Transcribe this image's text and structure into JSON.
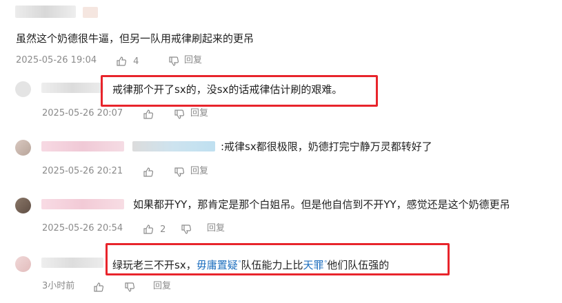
{
  "comments": [
    {
      "text": "虽然这个奶德很牛逼，但另一队用戒律刷起来的更吊",
      "date": "2025-05-26 19:04",
      "likes": "4",
      "reply_label": "回复"
    },
    {
      "text": "戒律那个开了sx的，没sx的话戒律估计刷的艰难。",
      "date": "2025-05-26 20:07",
      "likes": "",
      "reply_label": "回复"
    },
    {
      "text": ":戒律sx都很极限，奶德打完宁静万灵都转好了",
      "date": "2025-05-26 20:21",
      "likes": "",
      "reply_label": "回复"
    },
    {
      "text": "如果都开YY，那肯定是那个白姐吊。但是他自信到不开YY，感觉还是这个奶德更吊",
      "date": "2025-05-26 20:54",
      "likes": "2",
      "reply_label": "回复"
    },
    {
      "text_a": "绿玩老三不开sx，",
      "link_1": "毋庸置疑",
      "text_b": "队伍能力上比",
      "link_2": "天罪",
      "text_c": "他们队伍强的",
      "date": "3小时前",
      "likes": "",
      "reply_label": "回复"
    }
  ],
  "colors": {
    "highlight": "#e8242b",
    "link": "#1e6fbf",
    "meta": "#8a8a8a"
  },
  "icons": {
    "like": "thumbs-up-icon",
    "dislike": "thumbs-down-icon",
    "search_hint": "search-icon"
  }
}
